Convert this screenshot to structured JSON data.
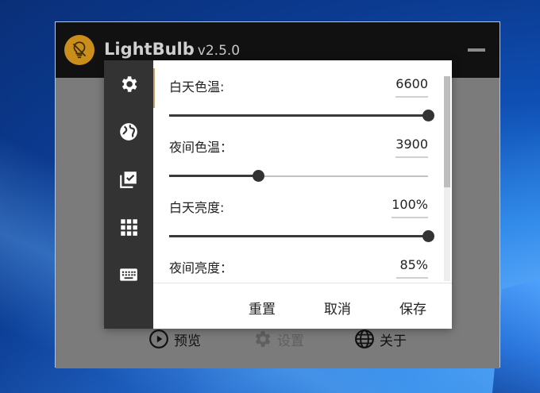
{
  "app": {
    "title": "LightBulb",
    "version": "v2.5.0"
  },
  "window_controls": {
    "minimize_icon": "minus-icon"
  },
  "background_nav": {
    "preview": "预览",
    "settings": "设置",
    "about": "关于"
  },
  "dialog": {
    "rail": [
      {
        "icon": "gear-icon",
        "active": true
      },
      {
        "icon": "globe-icon"
      },
      {
        "icon": "checklist-icon"
      },
      {
        "icon": "grid-apps-icon"
      },
      {
        "icon": "keyboard-icon"
      }
    ],
    "settings": [
      {
        "label": "白天色温:",
        "value": "6600",
        "level": 1.0
      },
      {
        "label": "夜间色温：",
        "value": "3900",
        "level": 0.344
      },
      {
        "label": "白天亮度:",
        "value": "100%",
        "level": 1.0
      },
      {
        "label": "夜间亮度：",
        "value": "85%",
        "level": 0.85
      }
    ],
    "actions": {
      "reset": "重置",
      "cancel": "取消",
      "save": "保存"
    }
  },
  "colors": {
    "accent": "#c98f1a",
    "rail_bg": "#333333",
    "titlebar_bg": "#111111"
  }
}
